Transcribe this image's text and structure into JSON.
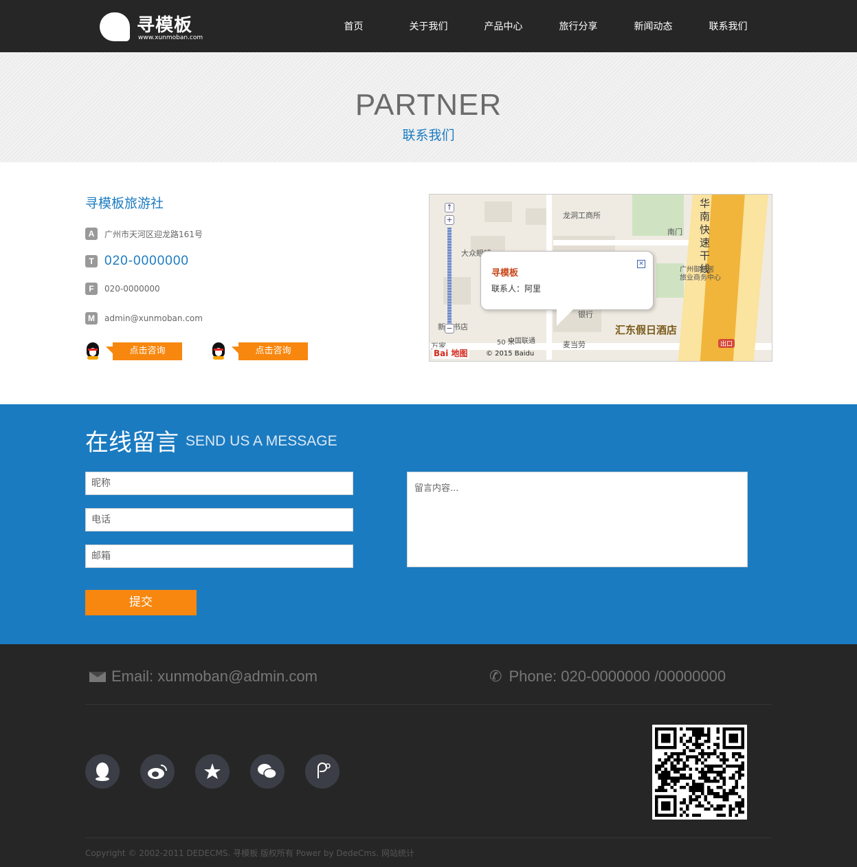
{
  "header": {
    "logo_name": "寻模板",
    "logo_url": "www.xunmoban.com",
    "nav": [
      "首页",
      "关于我们",
      "产品中心",
      "旅行分享",
      "新闻动态",
      "联系我们"
    ]
  },
  "banner": {
    "title": "PARTNER",
    "subtitle": "联系我们"
  },
  "contact": {
    "company": "寻模板旅游社",
    "address_badge": "A",
    "address": "广州市天河区迎龙路161号",
    "tel_badge": "T",
    "tel": "020-0000000",
    "fax_badge": "F",
    "fax": "020-0000000",
    "mail_badge": "M",
    "email": "admin@xunmoban.com",
    "qq_buttons": [
      "点击咨询",
      "点击咨询"
    ]
  },
  "map": {
    "labels": [
      "龙洞工商所",
      "大众眼镜",
      "南门",
      "广州御游居",
      "旅业商务中心",
      "银行",
      "新华书店",
      "中国联通",
      "麦当劳",
      "万家",
      "出口",
      "50 米"
    ],
    "hotel": "汇东假日酒店",
    "highway": "华南快速干线",
    "popup_title": "寻模板",
    "popup_text": "联系人：阿里",
    "baidu": "Bai 地图",
    "copyright": "© 2015 Baidu"
  },
  "message": {
    "title": "在线留言",
    "subtitle": "SEND US A MESSAGE",
    "nickname_placeholder": "昵称",
    "phone_placeholder": "电话",
    "email_placeholder": "邮箱",
    "content_placeholder": "留言内容...",
    "submit": "提交"
  },
  "footer": {
    "email": "Email: xunmoban@admin.com",
    "phone": "Phone: 020-0000000 /00000000",
    "social_icons": [
      "qq-icon",
      "weibo-icon",
      "tencent-weibo-icon",
      "wechat-icon",
      "douban-icon"
    ],
    "copyright": "Copyright © 2002-2011 DEDECMS. 寻模板 版权所有 Power by DedeCms. 网站统计"
  },
  "colors": {
    "header_bg": "#262626",
    "accent_blue": "#1b7bc1",
    "accent_orange": "#f7870f",
    "footer_bg": "#262626"
  }
}
